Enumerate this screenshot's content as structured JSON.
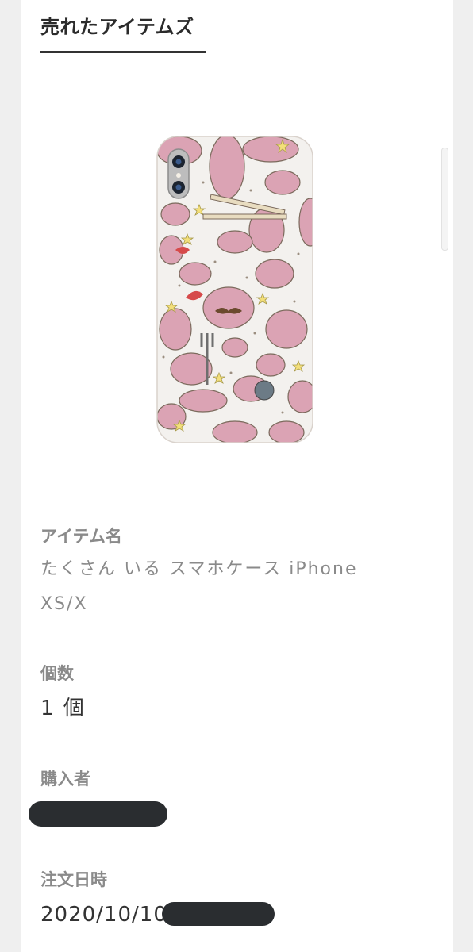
{
  "section": {
    "title": "売れたアイテムズ"
  },
  "item": {
    "name_label": "アイテム名",
    "name_line1": "たくさん いる スマホケース iPhone",
    "name_line2": "XS/X"
  },
  "quantity": {
    "label": "個数",
    "value": "1 個"
  },
  "buyer": {
    "label": "購入者"
  },
  "order_date": {
    "label": "注文日時",
    "value": "2020/10/10"
  }
}
